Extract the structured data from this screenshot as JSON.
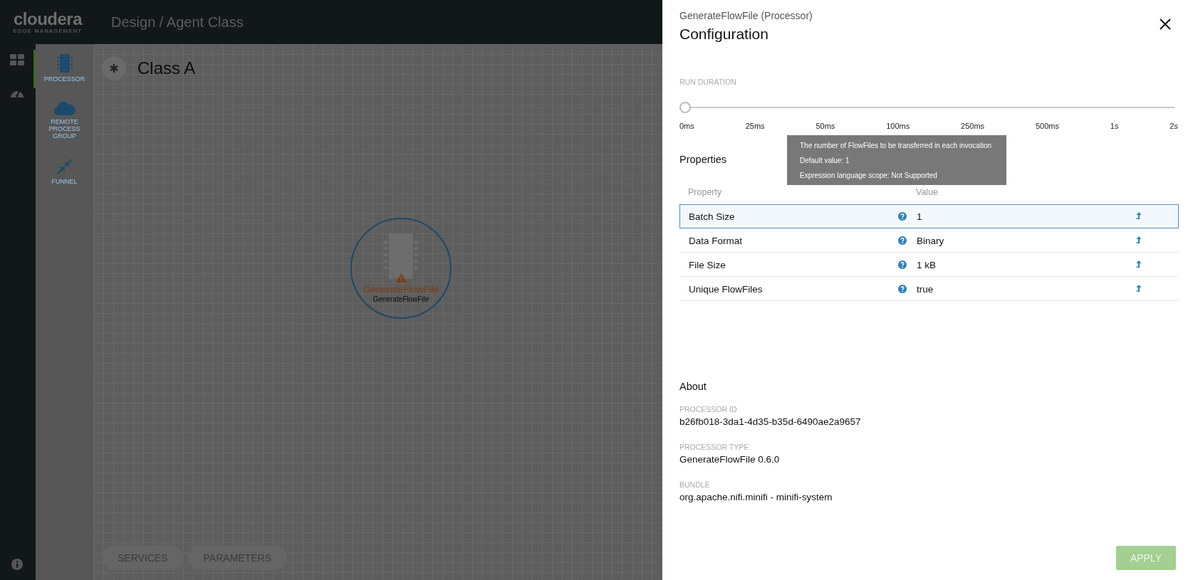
{
  "header": {
    "logo": "cloudera",
    "logo_subtitle": "EDGE MANAGEMENT",
    "breadcrumb": "Design / Agent Class"
  },
  "palette": [
    {
      "kind": "processor",
      "label": "PROCESSOR",
      "selected": true
    },
    {
      "kind": "remote-group",
      "label": "REMOTE PROCESS GROUP",
      "selected": false
    },
    {
      "kind": "funnel",
      "label": "FUNNEL",
      "selected": false
    }
  ],
  "canvas": {
    "title": "Class A",
    "node": {
      "name": "GenerateFlowFile",
      "type": "GenerateFlowFile",
      "warning": true
    },
    "buttons": [
      "SERVICES",
      "PARAMETERS"
    ]
  },
  "panel": {
    "subtitle": "GenerateFlowFile (Processor)",
    "title": "Configuration",
    "run_duration": {
      "label": "RUN DURATION",
      "level": 0,
      "ticks": [
        "0ms",
        "25ms",
        "50ms",
        "100ms",
        "250ms",
        "500ms",
        "1s",
        "2s"
      ]
    },
    "properties": {
      "title": "Properties",
      "columns": [
        "Property",
        "Value"
      ],
      "rows": [
        {
          "name": "Batch Size",
          "value": "1",
          "selected": true
        },
        {
          "name": "Data Format",
          "value": "Binary",
          "selected": false
        },
        {
          "name": "File Size",
          "value": "1 kB",
          "selected": false
        },
        {
          "name": "Unique FlowFiles",
          "value": "true",
          "selected": false
        }
      ]
    },
    "tooltip": {
      "lines": [
        "The number of FlowFiles to be transferred in each invocation",
        "Default value: 1",
        "Expression language scope: Not Supported"
      ]
    },
    "about": {
      "title": "About",
      "fields": [
        {
          "label": "PROCESSOR ID",
          "value": "b26fb018-3da1-4d35-b35d-6490ae2a9657"
        },
        {
          "label": "PROCESSOR TYPE",
          "value": "GenerateFlowFile 0.6.0"
        },
        {
          "label": "BUNDLE",
          "value": "org.apache.nifi.minifi - minifi-system"
        }
      ]
    },
    "apply_button": {
      "label": "APPLY",
      "disabled": true
    }
  }
}
